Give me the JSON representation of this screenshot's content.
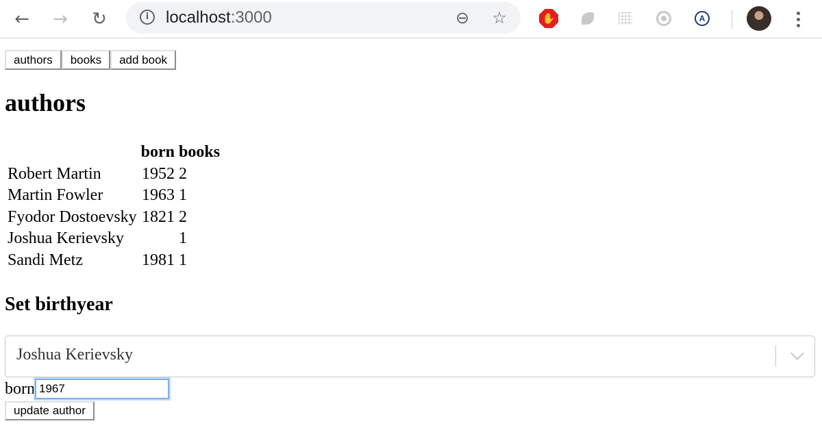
{
  "browser": {
    "url_host": "localhost",
    "url_port": ":3000",
    "icons": {
      "back": "arrow-left-icon",
      "forward": "arrow-right-icon",
      "reload": "reload-icon",
      "info": "info-icon",
      "zoom": "zoom-out-icon",
      "bookmark": "star-icon",
      "menu": "kebab-menu-icon"
    }
  },
  "nav": {
    "authors_label": "authors",
    "books_label": "books",
    "add_book_label": "add book"
  },
  "page": {
    "title": "authors",
    "table": {
      "headers": [
        "",
        "born",
        "books"
      ],
      "rows": [
        {
          "name": "Robert Martin",
          "born": "1952",
          "books": "2"
        },
        {
          "name": "Martin Fowler",
          "born": "1963",
          "books": "1"
        },
        {
          "name": "Fyodor Dostoevsky",
          "born": "1821",
          "books": "2"
        },
        {
          "name": "Joshua Kerievsky",
          "born": "",
          "books": "1"
        },
        {
          "name": "Sandi Metz",
          "born": "1981",
          "books": "1"
        }
      ]
    },
    "set_birthyear": {
      "title": "Set birthyear",
      "selected_author": "Joshua Kerievsky",
      "born_label": "born",
      "born_value": "1967",
      "submit_label": "update author"
    }
  },
  "colors": {
    "focus_border": "#7eadea",
    "adblock_red": "#e41e1e"
  }
}
